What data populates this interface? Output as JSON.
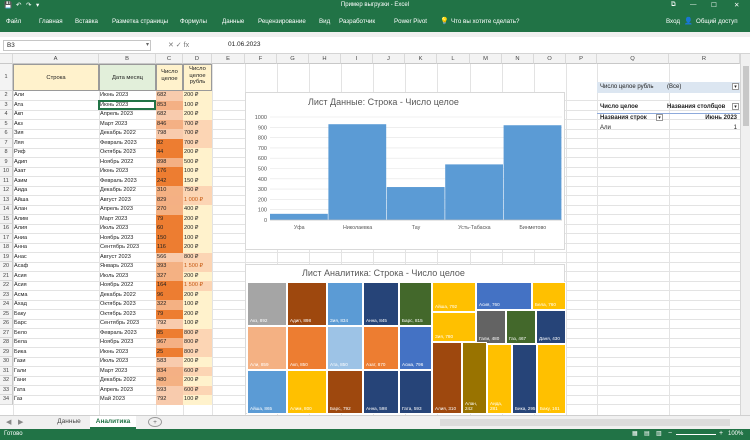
{
  "window": {
    "title": "Пример выгрузки - Excel",
    "controls": {
      "restore": "⧉",
      "minimize": "—",
      "maximize": "☐",
      "close": "✕"
    }
  },
  "ribbon": {
    "tabs": [
      "Файл",
      "Главная",
      "Вставка",
      "Разметка страницы",
      "Формулы",
      "Данные",
      "Рецензирование",
      "Вид",
      "Разработчик",
      "Power Pivot"
    ],
    "tell_me": "Что вы хотите сделать?",
    "sign_in": "Вход",
    "share": "Общий доступ"
  },
  "formula_bar": {
    "name_box": "B3",
    "fx_icons": "✕   ✓   fx",
    "value": "01.06.2023"
  },
  "columns": [
    "A",
    "B",
    "C",
    "D",
    "E",
    "F",
    "G",
    "H",
    "I",
    "J",
    "K",
    "L",
    "M",
    "N",
    "O",
    "P",
    "Q",
    "R"
  ],
  "header_row": {
    "a": "Строка",
    "b": "Дата месяц",
    "c": "Число целое",
    "d": "Число целое рубль"
  },
  "rows": [
    {
      "n": "2",
      "a": "Али",
      "b": "Июнь 2023",
      "c": "682",
      "d": "200 ₽"
    },
    {
      "n": "3",
      "a": "Ата",
      "b": "Июнь 2023",
      "c": "853",
      "d": "100 ₽"
    },
    {
      "n": "4",
      "a": "Акп",
      "b": "Апрель 2023",
      "c": "682",
      "d": "200 ₽"
    },
    {
      "n": "5",
      "a": "Акз",
      "b": "Март 2023",
      "c": "846",
      "d": "700 ₽"
    },
    {
      "n": "6",
      "a": "Зия",
      "b": "Декабрь 2022",
      "c": "798",
      "d": "700 ₽"
    },
    {
      "n": "7",
      "a": "Ляя",
      "b": "Февраль 2023",
      "c": "82",
      "d": "700 ₽"
    },
    {
      "n": "8",
      "a": "Риф",
      "b": "Октябрь 2023",
      "c": "44",
      "d": "200 ₽"
    },
    {
      "n": "9",
      "a": "Адип",
      "b": "Ноябрь 2022",
      "c": "898",
      "d": "500 ₽"
    },
    {
      "n": "10",
      "a": "Азат",
      "b": "Июнь 2023",
      "c": "176",
      "d": "100 ₽"
    },
    {
      "n": "11",
      "a": "Азим",
      "b": "Февраль 2023",
      "c": "242",
      "d": "150 ₽"
    },
    {
      "n": "12",
      "a": "Аида",
      "b": "Декабрь 2022",
      "c": "310",
      "d": "750 ₽"
    },
    {
      "n": "13",
      "a": "Айша",
      "b": "Август 2023",
      "c": "829",
      "d": "1 000 ₽"
    },
    {
      "n": "14",
      "a": "Алан",
      "b": "Апрель 2023",
      "c": "270",
      "d": "400 ₽"
    },
    {
      "n": "15",
      "a": "Алим",
      "b": "Март 2023",
      "c": "79",
      "d": "200 ₽"
    },
    {
      "n": "16",
      "a": "Алия",
      "b": "Июль 2023",
      "c": "60",
      "d": "200 ₽"
    },
    {
      "n": "17",
      "a": "Аниа",
      "b": "Ноябрь 2023",
      "c": "150",
      "d": "100 ₽"
    },
    {
      "n": "18",
      "a": "Анна",
      "b": "Сентябрь 2023",
      "c": "116",
      "d": "200 ₽"
    },
    {
      "n": "19",
      "a": "Анас",
      "b": "Август 2023",
      "c": "566",
      "d": "800 ₽"
    },
    {
      "n": "20",
      "a": "Асаф",
      "b": "Январь 2023",
      "c": "393",
      "d": "1 500 ₽"
    },
    {
      "n": "21",
      "a": "Асия",
      "b": "Июль 2023",
      "c": "327",
      "d": "200 ₽"
    },
    {
      "n": "22",
      "a": "Асия",
      "b": "Ноябрь 2022",
      "c": "164",
      "d": "1 500 ₽"
    },
    {
      "n": "23",
      "a": "Асма",
      "b": "Декабрь 2022",
      "c": "96",
      "d": "200 ₽"
    },
    {
      "n": "24",
      "a": "Ахад",
      "b": "Октябрь 2023",
      "c": "322",
      "d": "100 ₽"
    },
    {
      "n": "25",
      "a": "Баку",
      "b": "Октябрь 2023",
      "c": "79",
      "d": "200 ₽"
    },
    {
      "n": "26",
      "a": "Барс",
      "b": "Сентябрь 2023",
      "c": "792",
      "d": "100 ₽"
    },
    {
      "n": "27",
      "a": "Бело",
      "b": "Февраль 2023",
      "c": "85",
      "d": "800 ₽"
    },
    {
      "n": "28",
      "a": "Бела",
      "b": "Ноябрь 2023",
      "c": "967",
      "d": "800 ₽"
    },
    {
      "n": "29",
      "a": "Бика",
      "b": "Июнь 2023",
      "c": "25",
      "d": "800 ₽"
    },
    {
      "n": "30",
      "a": "Гази",
      "b": "Июль 2023",
      "c": "583",
      "d": "200 ₽"
    },
    {
      "n": "31",
      "a": "Гали",
      "b": "Март 2023",
      "c": "834",
      "d": "600 ₽"
    },
    {
      "n": "32",
      "a": "Гани",
      "b": "Декабрь 2022",
      "c": "480",
      "d": "200 ₽"
    },
    {
      "n": "33",
      "a": "Гата",
      "b": "Апрель 2023",
      "c": "593",
      "d": "600 ₽"
    },
    {
      "n": "34",
      "a": "Газ",
      "b": "Май 2023",
      "c": "792",
      "d": "100 ₽"
    }
  ],
  "chart1": {
    "title": "Лист Данные: Строка - Число целое"
  },
  "chart_data": [
    {
      "type": "bar",
      "title": "Лист Данные: Строка - Число целое",
      "categories": [
        "Уфа",
        "Николаевка",
        "Тау",
        "Усть-Табаска",
        "Бинметово"
      ],
      "values": [
        60,
        930,
        320,
        540,
        920
      ],
      "ylim": [
        0,
        1000
      ],
      "yticks": [
        "0",
        "100",
        "200",
        "300",
        "400",
        "500",
        "600",
        "700",
        "800",
        "900",
        "1000"
      ],
      "color": "#5b9bd5",
      "grid": true
    },
    {
      "type": "treemap",
      "title": "Лист Аналитика: Строка - Число целое",
      "labels": [
        "Акз, 892",
        "Адип, 898",
        "Зия, 834",
        "Анна, 845",
        "Барс, 815",
        "Айша, 792",
        "Зия, 780",
        "Асия, 760",
        "Бела, 760",
        "Али, 859",
        "Акп, 850",
        "Ата, 850",
        "Азат, 870",
        "Асма, 796",
        "Айша, 865",
        "Алим, 800",
        "Барс, 792",
        "Анна, 598",
        "Гата, 593",
        "Гали, 480",
        "Газ, 467",
        "Даня, 430",
        "Алия, 310",
        "Алан, 242",
        "Аида, 281",
        "Бика, 295",
        "Баку, 161"
      ]
    }
  ],
  "chart2": {
    "title": "Лист Аналитика: Строка - Число целое",
    "tiles": [
      {
        "label": "Акз, 892",
        "color": "#a5a5a5"
      },
      {
        "label": "Адип, 898",
        "color": "#9e480e"
      },
      {
        "label": "Зия, 834",
        "color": "#5b9bd5"
      },
      {
        "label": "Анна, 845",
        "color": "#264478"
      },
      {
        "label": "Барс, 815",
        "color": "#43682b"
      },
      {
        "label": "Айша, 792",
        "color": "#ffc000"
      },
      {
        "label": "Зия, 780",
        "color": "#ffc000"
      },
      {
        "label": "Асия, 760",
        "color": "#4472c4"
      },
      {
        "label": "Бела, 760",
        "color": "#ffc000"
      },
      {
        "label": "Али, 859",
        "color": "#f4b183"
      },
      {
        "label": "Акп, 850",
        "color": "#ed7d31"
      },
      {
        "label": "Ата, 850",
        "color": "#9dc3e6"
      },
      {
        "label": "Азат, 870",
        "color": "#ed7d31"
      },
      {
        "label": "Асма, 796",
        "color": "#4472c4"
      },
      {
        "label": "Айша, 865",
        "color": "#5b9bd5"
      },
      {
        "label": "Алим, 800",
        "color": "#ffc000"
      },
      {
        "label": "Барс, 792",
        "color": "#9e480e"
      },
      {
        "label": "Анна, 598",
        "color": "#264478"
      },
      {
        "label": "Гата, 593",
        "color": "#264478"
      },
      {
        "label": "Гали, 480",
        "color": "#636363"
      },
      {
        "label": "Газ, 467",
        "color": "#43682b"
      },
      {
        "label": "Даня, 430",
        "color": "#264478"
      },
      {
        "label": "Алия, 310",
        "color": "#9e480e"
      },
      {
        "label": "Алан, 242",
        "color": "#997300"
      },
      {
        "label": "Аида, 281",
        "color": "#ffc000"
      },
      {
        "label": "Бика, 295",
        "color": "#264478"
      },
      {
        "label": "Баку, 161",
        "color": "#ffc000"
      }
    ]
  },
  "pivot": {
    "filter_label": "Число целое рубль",
    "filter_value": "(Все)",
    "value_header": "Число целое",
    "col_header": "Названия столбцов",
    "row_header": "Названия строк",
    "col_value": "Июнь 2023",
    "row_label": "Али",
    "row_value": "1"
  },
  "sheets": {
    "tab1": "Данные",
    "tab2": "Аналитика",
    "add": "+"
  },
  "status": {
    "ready": "Готово",
    "zoom": "100%"
  }
}
